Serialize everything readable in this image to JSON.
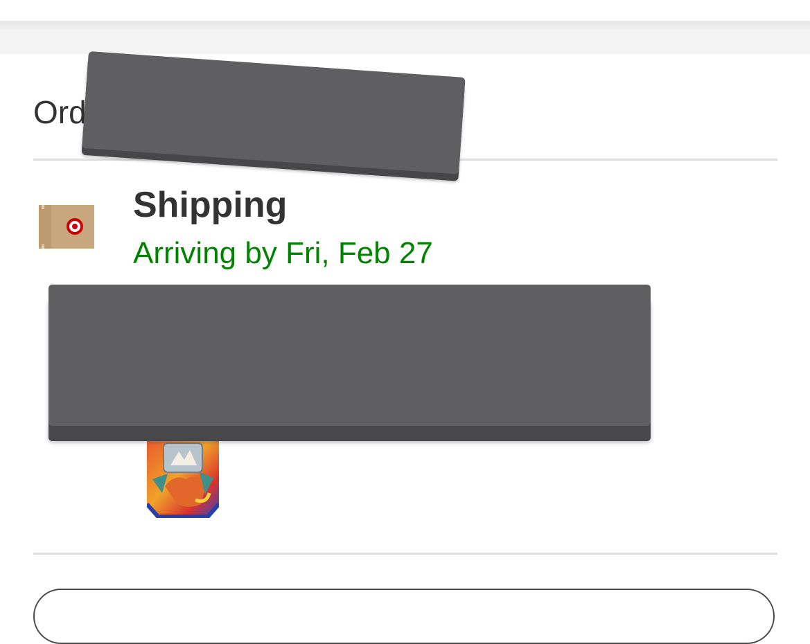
{
  "order": {
    "label_visible": "Ord"
  },
  "shipment": {
    "status_title": "Shipping",
    "arrival_text": "Arriving by Fri, Feb 27",
    "arrival_color": "#008300",
    "icon": "target-package-icon"
  },
  "product": {
    "thumbnail": "pokemon-card-product-image"
  },
  "colors": {
    "brand_red": "#cc0000",
    "text": "#333333",
    "divider": "#dedede"
  }
}
